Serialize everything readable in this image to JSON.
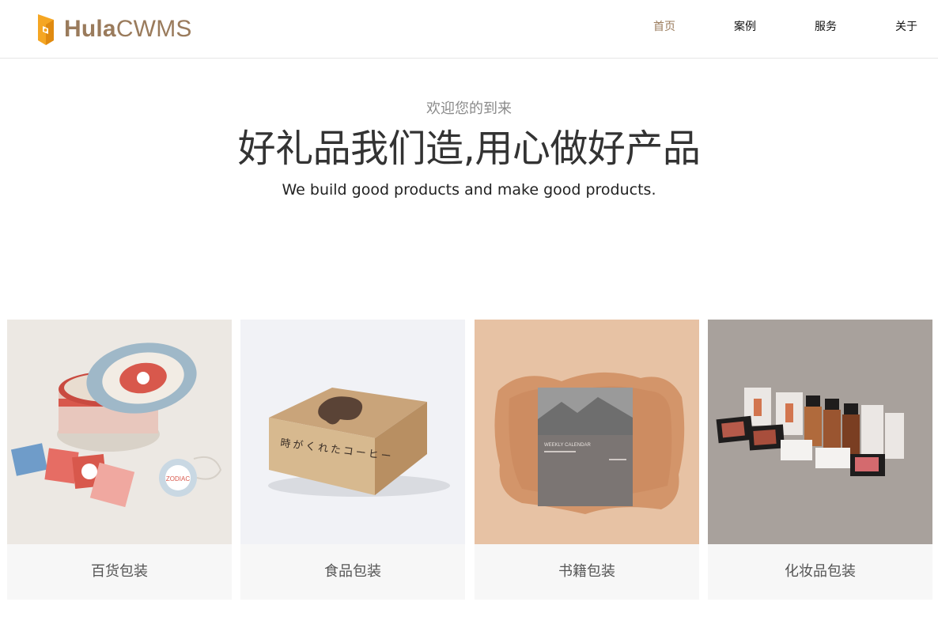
{
  "brand": {
    "name_bold": "Hula",
    "name_light": "CWMS",
    "logo_icon": "hula-logo-icon",
    "accent": "#9a7b5c",
    "logo_color": "#f5a623"
  },
  "nav": {
    "items": [
      {
        "label": "首页",
        "active": true
      },
      {
        "label": "案例",
        "active": false
      },
      {
        "label": "服务",
        "active": false
      },
      {
        "label": "关于",
        "active": false
      }
    ]
  },
  "hero": {
    "welcome": "欢迎您的到来",
    "headline": "好礼品我们造,用心做好产品",
    "subtitle": "We build good products and make good products."
  },
  "cards": [
    {
      "caption": "百货包装",
      "image": "zodiac-tin-packaging-image",
      "box_text": "ZODIAC"
    },
    {
      "caption": "食品包装",
      "image": "kraft-food-box-image",
      "box_text": "時がくれたコーヒー"
    },
    {
      "caption": "书籍包装",
      "image": "calendar-book-packaging-image",
      "box_text": "WEEKLY CALENDAR"
    },
    {
      "caption": "化妆品包装",
      "image": "cosmetics-packaging-image",
      "box_text": ""
    }
  ]
}
